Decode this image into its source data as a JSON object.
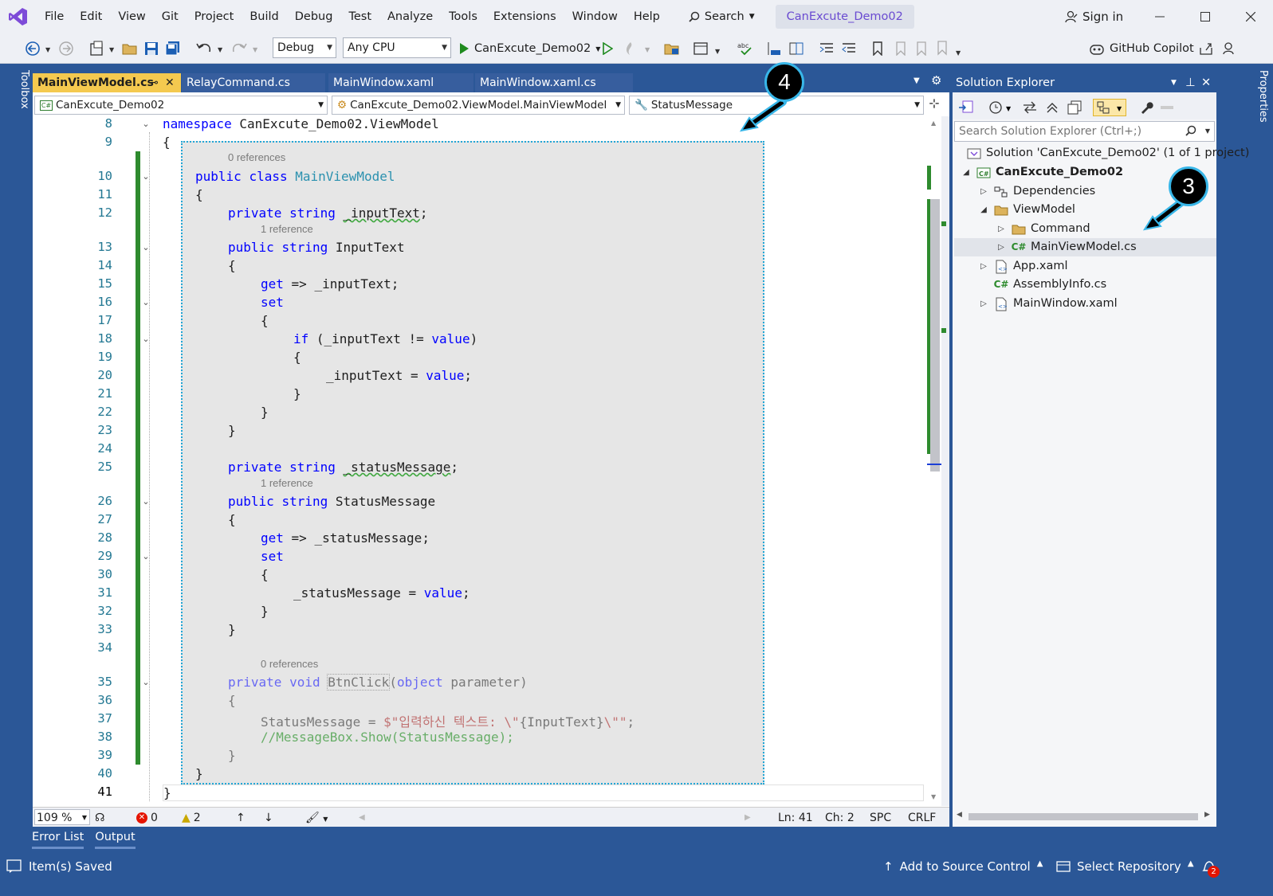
{
  "menu": [
    "File",
    "Edit",
    "View",
    "Git",
    "Project",
    "Build",
    "Debug",
    "Test",
    "Analyze",
    "Tools",
    "Extensions",
    "Window",
    "Help"
  ],
  "search": {
    "label": "Search"
  },
  "solution_title": "CanExcute_Demo02",
  "signin": "Sign in",
  "toolbar": {
    "config": "Debug",
    "platform": "Any CPU",
    "run_target": "CanExcute_Demo02",
    "copilot": "GitHub Copilot"
  },
  "side": {
    "toolbox": "Toolbox",
    "properties": "Properties"
  },
  "tabs": [
    {
      "label": "MainViewModel.cs",
      "active": true
    },
    {
      "label": "RelayCommand.cs"
    },
    {
      "label": "MainWindow.xaml"
    },
    {
      "label": "MainWindow.xaml.cs"
    }
  ],
  "nav": {
    "project": "CanExcute_Demo02",
    "type": "CanExcute_Demo02.ViewModel.MainViewModel",
    "member": "StatusMessage"
  },
  "code": {
    "line_numbers": [
      "8",
      "9",
      "10",
      "11",
      "12",
      "13",
      "14",
      "15",
      "16",
      "17",
      "18",
      "19",
      "20",
      "21",
      "22",
      "23",
      "24",
      "25",
      "26",
      "27",
      "28",
      "29",
      "30",
      "31",
      "32",
      "33",
      "34",
      "35",
      "36",
      "37",
      "38",
      "39",
      "40",
      "41"
    ],
    "lens_0refs": "0 references",
    "lens_1ref": "1 reference",
    "namespace_kw": "namespace",
    "namespace_name": " CanExcute_Demo02.ViewModel",
    "brace_open": "{",
    "brace_close": "}",
    "kw_public": "public",
    "kw_private": "private",
    "kw_class": "class",
    "kw_string": "string",
    "kw_void": "void",
    "kw_object": "object",
    "kw_get": "get",
    "kw_set": "set",
    "kw_if": "if",
    "kw_value": "value",
    "class_name": "MainViewModel",
    "f_input": "_inputText",
    "p_input": "InputText",
    "f_status": "_statusMessage",
    "p_status": "StatusMessage",
    "m_btn": "BtnClick",
    "param": "parameter",
    "arrow": "=>",
    "neq": "!=",
    "assign": "=",
    "semi": ";",
    "str_prefix": "$\"입력하신 텍스트: \\\"",
    "str_interp": "{InputText}",
    "str_suffix": "\\\"\"",
    "comment": "//MessageBox.Show(StatusMessage);"
  },
  "editor_status": {
    "zoom": "109 %",
    "errors": "0",
    "warnings": "2",
    "ln": "Ln: 41",
    "ch": "Ch: 2",
    "spc": "SPC",
    "crlf": "CRLF"
  },
  "solution_explorer": {
    "title": "Solution Explorer",
    "search_placeholder": "Search Solution Explorer (Ctrl+;)",
    "items": [
      {
        "label": "Solution 'CanExcute_Demo02' (1 of 1 project)"
      },
      {
        "label": "CanExcute_Demo02"
      },
      {
        "label": "Dependencies"
      },
      {
        "label": "ViewModel"
      },
      {
        "label": "Command"
      },
      {
        "label": "MainViewModel.cs"
      },
      {
        "label": "App.xaml"
      },
      {
        "label": "AssemblyInfo.cs"
      },
      {
        "label": "MainWindow.xaml"
      }
    ]
  },
  "bottom_tabs": [
    "Error List",
    "Output"
  ],
  "statusbar": {
    "message": "Item(s) Saved",
    "source_control": "Add to Source Control",
    "repository": "Select Repository",
    "notifications": "2"
  },
  "callouts": [
    "4",
    "3"
  ],
  "colors": {
    "accent": "#2b5797",
    "keyword": "#0000ff",
    "type": "#2b91af",
    "change_bar": "#2e8b2e",
    "callout_border": "#38b6e8"
  }
}
